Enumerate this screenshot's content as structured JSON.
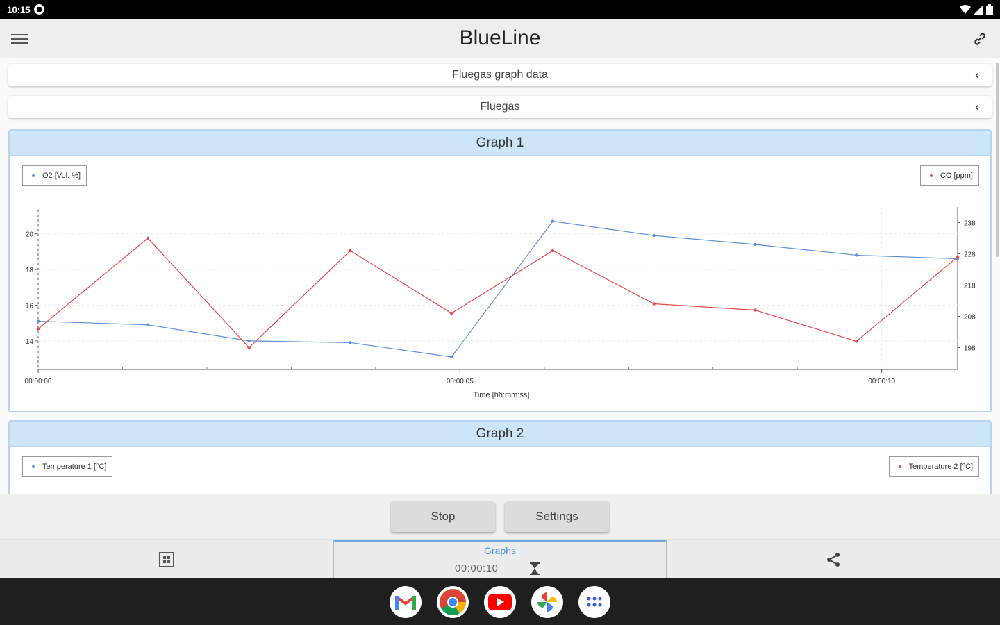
{
  "status_bar": {
    "time": "10:15"
  },
  "app_bar": {
    "title": "BlueLine"
  },
  "sections": [
    {
      "label": "Fluegas graph data"
    },
    {
      "label": "Fluegas"
    }
  ],
  "graph1": {
    "header": "Graph 1",
    "legend_left": "O2 [Vol. %]",
    "legend_right": "CO [ppm]"
  },
  "graph2": {
    "header": "Graph 2",
    "legend_left": "Temperature 1 [°C]",
    "legend_right": "Temperature 2 [°C]"
  },
  "chart_data": {
    "type": "line",
    "xlabel": "Time [hh:mm:ss]",
    "x_tick_labels": [
      "00:00:00",
      "00:00:05",
      "00:00:10"
    ],
    "x": [
      0,
      1.3,
      2.5,
      3.7,
      4.9,
      6.1,
      7.3,
      8.5,
      9.7,
      10.9
    ],
    "xlim": [
      0,
      10.9
    ],
    "y_left": {
      "ticks": [
        14,
        16,
        18,
        20
      ],
      "lim": [
        12.4,
        21.5
      ]
    },
    "y_right": {
      "ticks": [
        198,
        208,
        218,
        228,
        238
      ],
      "lim": [
        191,
        243
      ]
    },
    "series": [
      {
        "name": "O2 [Vol. %]",
        "axis": "left",
        "color": "#5b8fd6",
        "values": [
          15.1,
          14.9,
          14.0,
          13.9,
          13.1,
          20.7,
          19.9,
          19.4,
          18.8,
          18.6
        ]
      },
      {
        "name": "CO [ppm]",
        "axis": "right",
        "color": "#e8484e",
        "values": [
          204,
          233,
          198,
          229,
          209,
          229,
          212,
          210,
          200,
          227
        ]
      }
    ]
  },
  "buttons": {
    "stop": "Stop",
    "settings": "Settings"
  },
  "nav": {
    "graphs_label": "Graphs",
    "timer": "00:00:10"
  },
  "colors": {
    "accent": "#4a90d9",
    "header_bg": "#cde5f8",
    "o2": "#5b8fd6",
    "co": "#e8484e"
  },
  "dock_apps": [
    "gmail-icon",
    "chrome-icon",
    "youtube-icon",
    "photos-icon",
    "apps-icon"
  ]
}
